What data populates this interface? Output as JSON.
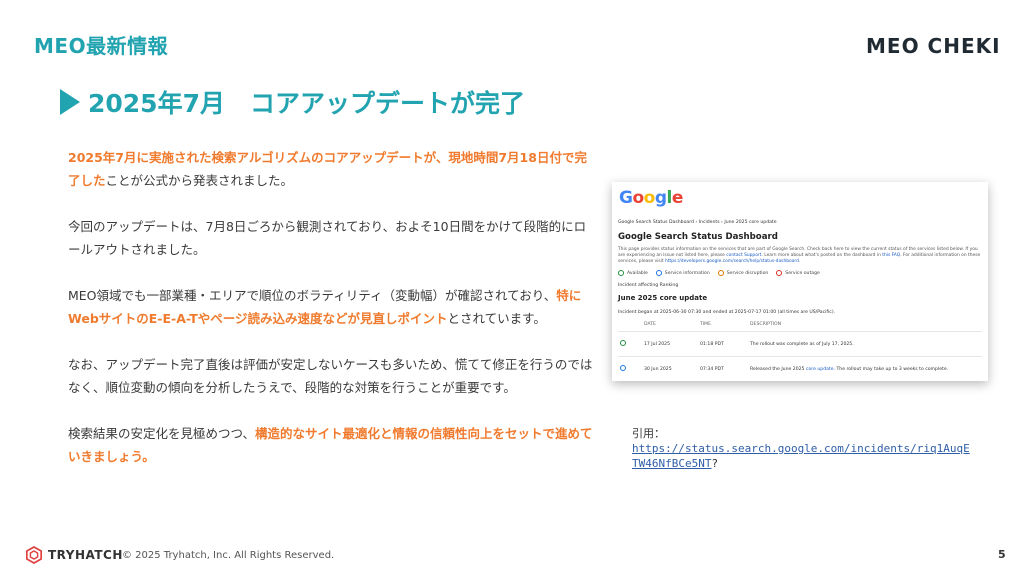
{
  "header": {
    "section_title": "MEO最新情報",
    "brand": "MEO CHEKI"
  },
  "headline": "2025年7月　コアアップデートが完了",
  "body": {
    "p1_highlight": "2025年7月に実施された検索アルゴリズムのコアアップデートが、現地時間7月18日付で完了した",
    "p1_rest": "ことが公式から発表されました。",
    "p2": "今回のアップデートは、7月8日ごろから観測されており、およそ10日間をかけて段階的にロールアウトされました。",
    "p3_start": "MEO領域でも一部業種・エリアで順位のボラティリティ（変動幅）が確認されており、",
    "p3_highlight": "特にWebサイトのE-E-A-Tやページ読み込み速度などが見直しポイント",
    "p3_end": "とされています。",
    "p4": "なお、アップデート完了直後は評価が安定しないケースも多いため、慌てて修正を行うのではなく、順位変動の傾向を分析したうえで、段階的な対策を行うことが重要です。",
    "p5_start": "検索結果の安定化を見極めつつ、",
    "p5_highlight": "構造的なサイト最適化と情報の信頼性向上をセットで進めていきましょう。"
  },
  "screenshot": {
    "logo": [
      "G",
      "o",
      "o",
      "g",
      "l",
      "e"
    ],
    "logo_colors": [
      "#4285F4",
      "#EA4335",
      "#FBBC05",
      "#4285F4",
      "#34A853",
      "#EA4335"
    ],
    "breadcrumb": "Google Search Status Dashboard  ›  Incidents  ›  June 2025 core update",
    "title": "Google Search Status Dashboard",
    "desc_before": "This page provides status information on the services that are part of Google Search. Check back here to view the current status of the services listed below. If you are experiencing an issue not listed here, please ",
    "desc_link1": "contact Support",
    "desc_middle": ". Learn more about what's posted on the dashboard in ",
    "desc_link2": "this FAQ",
    "desc_after": ". For additional information on these services, please visit ",
    "desc_link3": "https://developers.google.com/search/help/status-dashboard",
    "desc_end": ".",
    "legend": [
      "Available",
      "Service information",
      "Service disruption",
      "Service outage"
    ],
    "incident_affecting": "Incident affecting Ranking",
    "incident_title": "June 2025 core update",
    "incident_began": "Incident began at 2025-06-30 07:30 and ended at 2025-07-17 01:00 (all times are US/Pacific).",
    "columns": [
      "DATE",
      "TIME",
      "DESCRIPTION"
    ],
    "rows": [
      {
        "date": "17 Jul 2025",
        "time": "01:18 PDT",
        "desc": "The rollout was complete as of July 17, 2025."
      },
      {
        "date": "30 Jun 2025",
        "time": "07:34 PDT",
        "desc_before": "Released the June 2025 ",
        "desc_link": "core update",
        "desc_after": ". The rollout may take up to 3 weeks to complete."
      }
    ]
  },
  "citation": {
    "label": "引用：",
    "url": "https://status.search.google.com/incidents/riq1AuqETW46NfBCe5NT",
    "suffix": "?"
  },
  "footer": {
    "company": "TRYHATCH",
    "copyright": "© 2025 Tryhatch, Inc. All Rights Reserved.",
    "page": "5"
  }
}
